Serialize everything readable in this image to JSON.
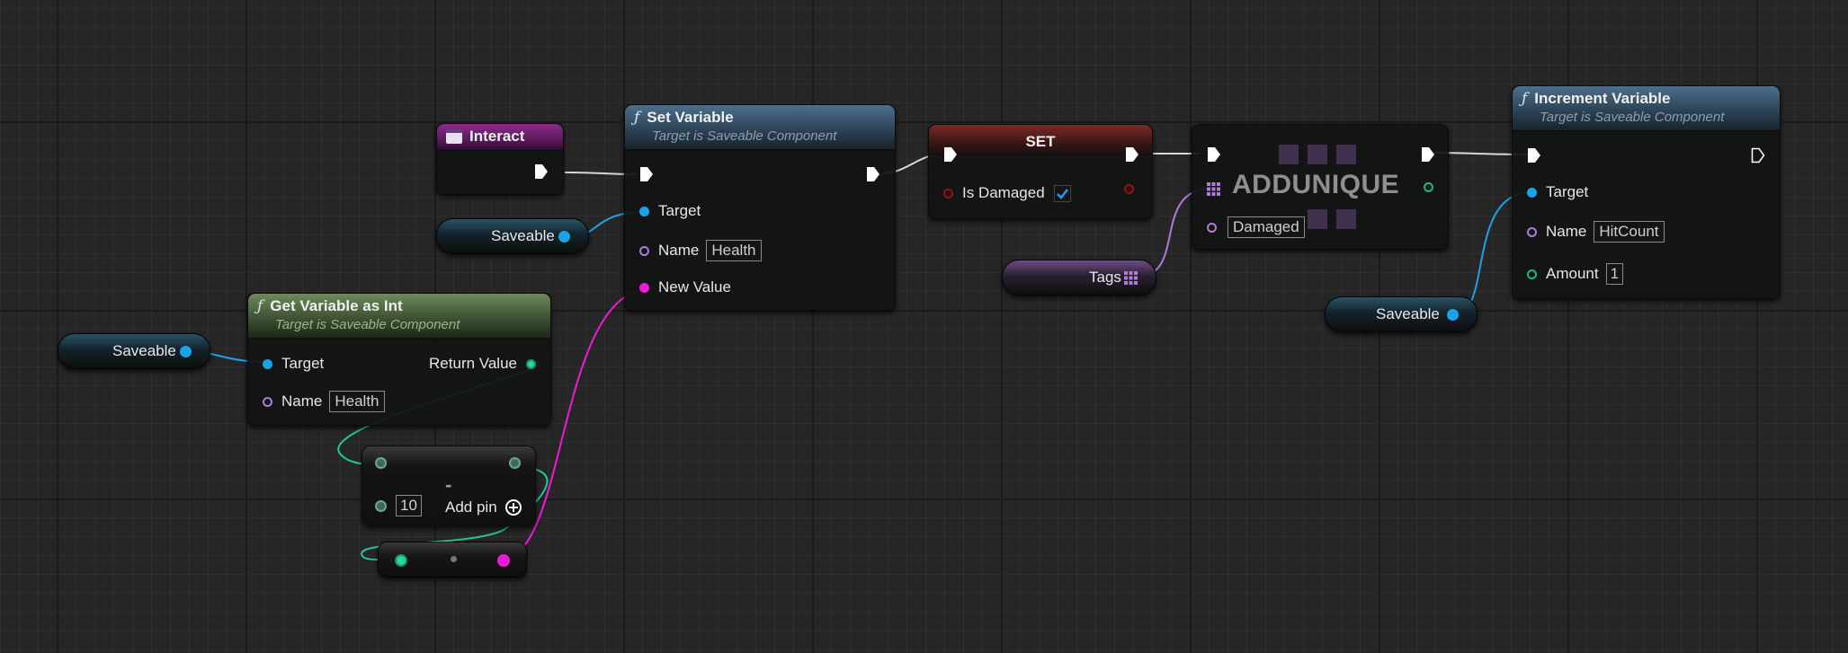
{
  "nodes": {
    "interact": {
      "title": "Interact"
    },
    "set_variable": {
      "title": "Set Variable",
      "subtitle": "Target is Saveable Component",
      "pins": {
        "target": "Target",
        "name": "Name",
        "new_value": "New Value"
      },
      "name_value": "Health"
    },
    "set_bool": {
      "title": "SET",
      "pin_label": "Is Damaged",
      "checked": true
    },
    "add_unique": {
      "title": "ADDUNIQUE",
      "name_value": "Damaged"
    },
    "increment_variable": {
      "title": "Increment Variable",
      "subtitle": "Target is Saveable Component",
      "pins": {
        "target": "Target",
        "name": "Name",
        "amount": "Amount"
      },
      "name_value": "HitCount",
      "amount_value": "1"
    },
    "get_variable_int": {
      "title": "Get Variable as Int",
      "subtitle": "Target is Saveable Component",
      "pins": {
        "target": "Target",
        "name": "Name",
        "return_value": "Return Value"
      },
      "name_value": "Health"
    },
    "subtract": {
      "operator": "-",
      "value": "10",
      "add_pin": "Add pin"
    },
    "saveable_1": {
      "label": "Saveable"
    },
    "saveable_2": {
      "label": "Saveable"
    },
    "saveable_3": {
      "label": "Saveable"
    },
    "tags": {
      "label": "Tags"
    }
  },
  "colors": {
    "exec": "#ffffff",
    "object": "#1aa3e8",
    "name": "#b07ad8",
    "int": "#23c79a",
    "float": "#f01ad8",
    "bool": "#8c1616"
  },
  "icons": [
    "function-icon",
    "event-icon",
    "exec-pin-icon",
    "add-pin-icon",
    "array-icon",
    "checkmark-icon"
  ]
}
